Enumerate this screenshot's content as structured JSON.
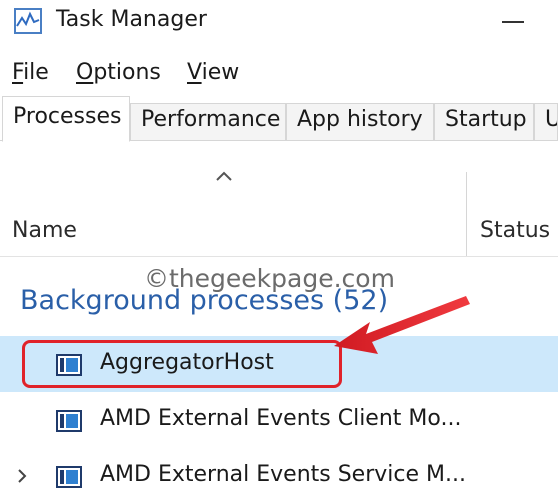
{
  "window": {
    "title": "Task Manager"
  },
  "menu": {
    "items": [
      {
        "underline": "F",
        "rest": "ile"
      },
      {
        "underline": "O",
        "rest": "ptions"
      },
      {
        "underline": "V",
        "rest": "iew"
      }
    ]
  },
  "tabs": [
    "Processes",
    "Performance",
    "App history",
    "Startup",
    "U"
  ],
  "columns": {
    "name": "Name",
    "status": "Status"
  },
  "watermark": "©thegeekpage.com",
  "group": {
    "label": "Background processes (52)"
  },
  "rows": [
    {
      "label": "AggregatorHost"
    },
    {
      "label": "AMD External Events Client Mo..."
    },
    {
      "label": "AMD External Events Service M..."
    }
  ],
  "colors": {
    "accent": "#2a5fa8",
    "selection": "#cde8fb",
    "annotation": "#e0222a"
  }
}
